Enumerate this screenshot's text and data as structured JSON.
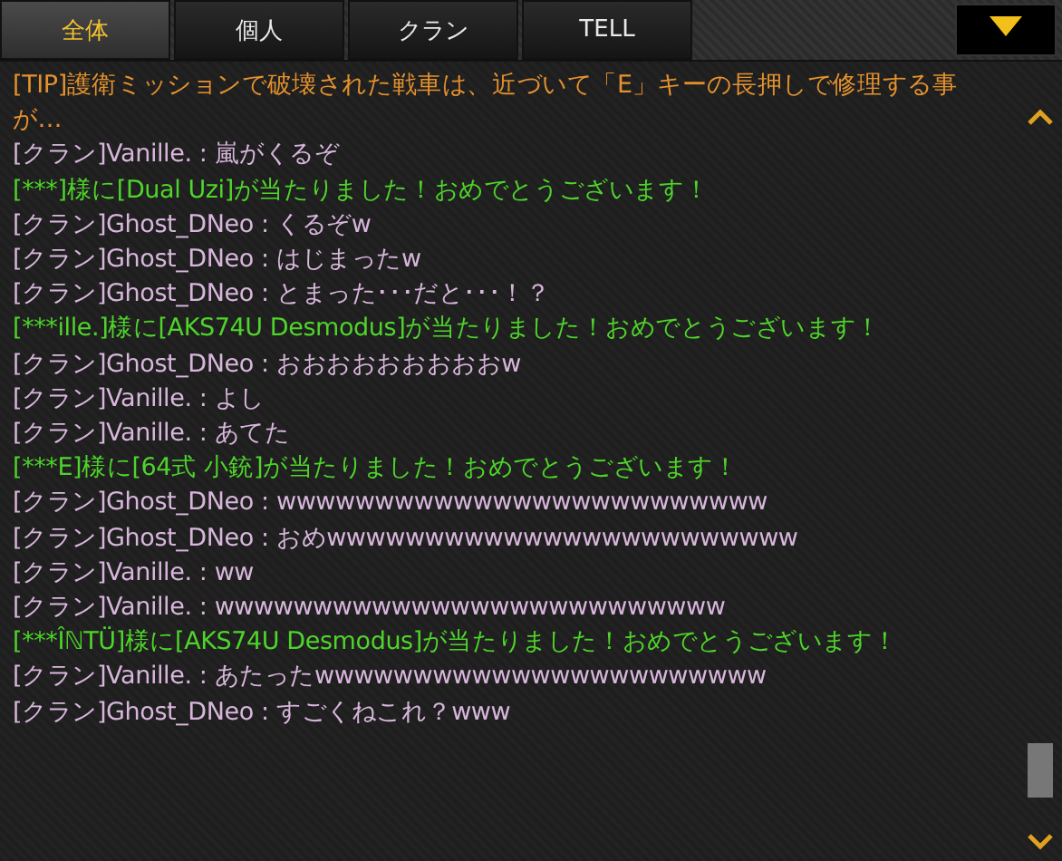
{
  "tabs": [
    {
      "label": "全体",
      "selected": true
    },
    {
      "label": "個人",
      "selected": false
    },
    {
      "label": "クラン",
      "selected": false
    },
    {
      "label": "TELL",
      "selected": false
    }
  ],
  "messages": [
    {
      "kind": "tip",
      "text": "[TIP]護衛ミッションで破壊された戦車は、近づいて「E」キーの長押しで修理する事が…"
    },
    {
      "kind": "clan",
      "text": "[クラン]Vanille. : 嵐がくるぞ"
    },
    {
      "kind": "system",
      "text": "[***]様に[Dual Uzi]が当たりました！おめでとうございます！"
    },
    {
      "kind": "clan",
      "text": "[クラン]Ghost_DNeo : くるぞw"
    },
    {
      "kind": "clan",
      "text": "[クラン]Ghost_DNeo : はじまったw"
    },
    {
      "kind": "clan",
      "text": "[クラン]Ghost_DNeo : とまった･･･だと･･･！？"
    },
    {
      "kind": "system",
      "text": "[***ille.]様に[AKS74U Desmodus]が当たりました！おめでとうございます！"
    },
    {
      "kind": "clan",
      "text": "[クラン]Ghost_DNeo : おおおおおおおおおw"
    },
    {
      "kind": "clan",
      "text": "[クラン]Vanille. : よし"
    },
    {
      "kind": "clan",
      "text": "[クラン]Vanille. : あてた"
    },
    {
      "kind": "system",
      "text": "[***E]様に[64式 小銃]が当たりました！おめでとうございます！"
    },
    {
      "kind": "clan",
      "text": "[クラン]Ghost_DNeo : wwwwwwwwwwwwwwwwwwwwwwwww"
    },
    {
      "kind": "clan",
      "text": "[クラン]Ghost_DNeo : おめwwwwwwwwwwwwwwwwwwwwwwww"
    },
    {
      "kind": "clan",
      "text": "[クラン]Vanille. : ww"
    },
    {
      "kind": "clan",
      "text": "[クラン]Vanille. : wwwwwwwwwwwwwwwwwwwwwwwwww"
    },
    {
      "kind": "system",
      "text": "[***ÎℕTÜ]様に[AKS74U Desmodus]が当たりました！おめでとうございます！"
    },
    {
      "kind": "clan",
      "text": "[クラン]Vanille. : あたったwwwwwwwwwwwwwwwwwwwwwww"
    },
    {
      "kind": "clan",
      "text": "[クラン]Ghost_DNeo : すごくねこれ？www"
    }
  ]
}
